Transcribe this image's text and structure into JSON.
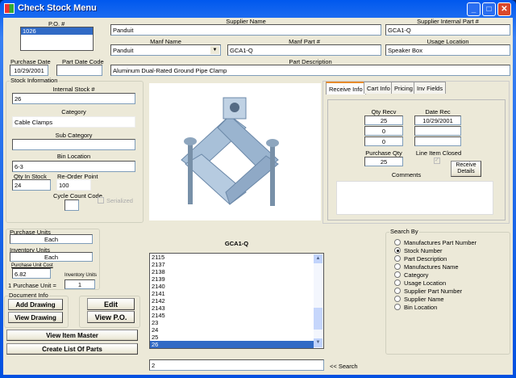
{
  "window": {
    "title": "Check Stock Menu",
    "minimize": "_",
    "maximize": "□",
    "close": "✕"
  },
  "po": {
    "label": "P.O. #",
    "items": [
      "1026"
    ]
  },
  "supplier_name": {
    "label": "Supplier Name",
    "value": "Panduit"
  },
  "supplier_internal_part": {
    "label": "Supplier Internal Part #",
    "value": "GCA1-Q"
  },
  "manf_name": {
    "label": "Manf Name",
    "value": "Panduit"
  },
  "manf_part": {
    "label": "Manf Part #",
    "value": "GCA1-Q"
  },
  "usage_location": {
    "label": "Usage Location",
    "value": "Speaker Box"
  },
  "purchase_date": {
    "label": "Purchase Date",
    "value": "10/29/2001"
  },
  "part_date_code": {
    "label": "Part Date Code",
    "value": ""
  },
  "part_description": {
    "label": "Part Description",
    "value": "Aluminum Dual-Rated Ground Pipe Clamp"
  },
  "stock": {
    "group": "Stock Information",
    "internal_label": "Internal Stock #",
    "internal": "26",
    "category_label": "Category",
    "category": "Cable Clamps",
    "subcategory_label": "Sub Category",
    "subcategory": "",
    "bin_label": "Bin Location",
    "bin": "6-3",
    "qty_label": "Qty In Stock",
    "qty": "24",
    "reorder_label": "Re-Order Point",
    "reorder": "100",
    "cycle_label": "Cycle Count Code",
    "cycle": "",
    "serialized_label": "Serialized"
  },
  "tabs": [
    "Receive Info",
    "Cart Info",
    "Pricing",
    "Inv Fields"
  ],
  "receive": {
    "qty_recv_label": "Qty Recv",
    "qty_recv": [
      "25",
      "0",
      "0"
    ],
    "date_rec_label": "Date Rec",
    "date_rec": [
      "10/29/2001",
      "",
      ""
    ],
    "purchase_qty_label": "Purchase Qty",
    "purchase_qty": "25",
    "line_closed_label": "Line Item Closed",
    "line_closed": true,
    "receive_details": "Receive Details",
    "comments_label": "Comments",
    "comments": ""
  },
  "units": {
    "purchase_label": "Purchase Units",
    "purchase": "Each",
    "inventory_label": "Inventory Units",
    "inventory": "Each",
    "cost_label": "Purchase Unit Cost",
    "cost": "6.82",
    "conv_label": "1 Purchase Unit =",
    "inv_units_label": "Inventory Units",
    "inv_units": "1"
  },
  "doc": {
    "group": "Document Info",
    "add": "Add Drawing",
    "view": "View Drawing"
  },
  "edit": "Edit",
  "view_po": "View P.O.",
  "view_item_master": "View Item Master",
  "create_list": "Create List Of Parts",
  "results": {
    "title": "GCA1-Q",
    "items": [
      "2115",
      "2137",
      "2138",
      "2139",
      "2140",
      "2141",
      "2142",
      "2143",
      "2145",
      "23",
      "24",
      "25",
      "26"
    ],
    "selected": "26"
  },
  "search": {
    "value": "2",
    "label": "<< Search"
  },
  "search_by": {
    "group": "Search By",
    "options": [
      "Manufactures Part Number",
      "Stock Number",
      "Part Description",
      "Manufactures Name",
      "Category",
      "Usage Location",
      "Supplier Part Number",
      "Supplier Name",
      "Bin Location"
    ],
    "selected": "Stock Number"
  }
}
